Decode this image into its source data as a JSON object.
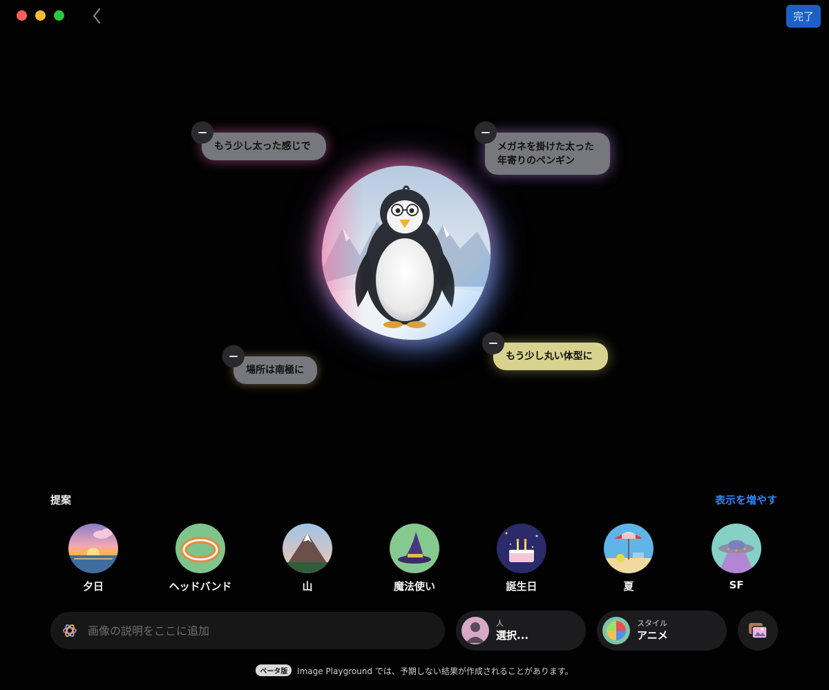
{
  "window": {
    "done_label": "完了"
  },
  "modifiers": [
    {
      "text": "もう少し太った感じで"
    },
    {
      "text_line1": "メガネを掛けた太った",
      "text_line2": "年寄りのペンギン"
    },
    {
      "text": "場所は南極に"
    },
    {
      "text": "もう少し丸い体型に"
    }
  ],
  "suggestions": {
    "title": "提案",
    "show_more": "表示を増やす",
    "items": [
      {
        "label": "夕日",
        "icon": "sunset-icon"
      },
      {
        "label": "ヘッドバンド",
        "icon": "headband-icon"
      },
      {
        "label": "山",
        "icon": "mountain-icon"
      },
      {
        "label": "魔法使い",
        "icon": "wizard-hat-icon"
      },
      {
        "label": "誕生日",
        "icon": "birthday-cake-icon"
      },
      {
        "label": "夏",
        "icon": "beach-umbrella-icon"
      },
      {
        "label": "SF",
        "icon": "ufo-icon"
      }
    ]
  },
  "prompt": {
    "placeholder": "画像の説明をここに追加"
  },
  "person": {
    "small": "人",
    "big": "選択..."
  },
  "style": {
    "small": "スタイル",
    "big": "アニメ"
  },
  "footer": {
    "badge": "ベータ版",
    "text": "Image Playground では、予期しない結果が作成されることがあります。"
  },
  "colors": {
    "accent": "#2f86ff",
    "done_button": "#1d5fc8",
    "background": "#020202"
  }
}
